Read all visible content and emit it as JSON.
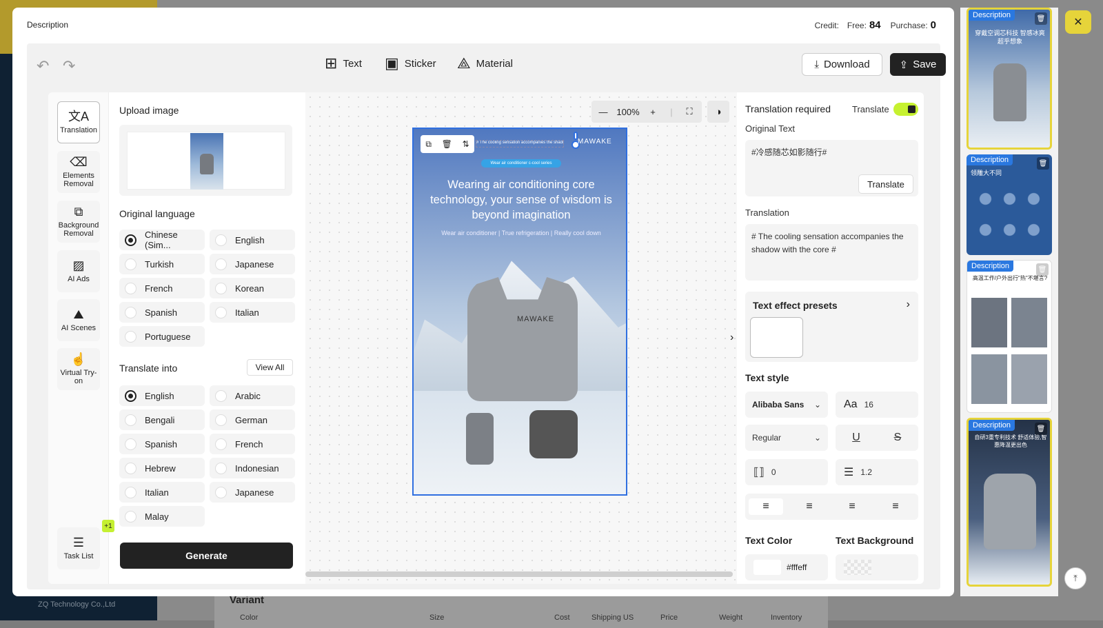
{
  "background": {
    "company": "ZQ Technology Co.,Ltd",
    "section": "Variant",
    "columns": [
      "Color",
      "Size",
      "Cost",
      "Shipping US",
      "Price",
      "Weight",
      "Inventory"
    ]
  },
  "modal": {
    "title": "Description",
    "credit": {
      "label": "Credit:",
      "free_label": "Free:",
      "free_value": "84",
      "purchase_label": "Purchase:",
      "purchase_value": "0"
    },
    "toolbar": {
      "text": "Text",
      "sticker": "Sticker",
      "material": "Material",
      "download": "Download",
      "save": "Save"
    },
    "rail": [
      {
        "label": "Translation",
        "icon": "translate-icon"
      },
      {
        "label": "Elements Removal",
        "icon": "eraser-icon"
      },
      {
        "label": "Background Removal",
        "icon": "bg-removal-icon"
      },
      {
        "label": "AI Ads",
        "icon": "ai-ads-icon"
      },
      {
        "label": "AI Scenes",
        "icon": "scene-icon"
      },
      {
        "label": "Virtual Try-on",
        "icon": "tryon-icon"
      }
    ],
    "task_list": {
      "label": "Task List",
      "badge": "+1"
    },
    "left": {
      "upload_title": "Upload image",
      "orig_title": "Original language",
      "orig_langs": [
        "Chinese (Sim...",
        "English",
        "Turkish",
        "Japanese",
        "French",
        "Korean",
        "Spanish",
        "Italian",
        "Portuguese"
      ],
      "into_title": "Translate into",
      "view_all": "View All",
      "into_langs": [
        "English",
        "Arabic",
        "Bengali",
        "German",
        "Spanish",
        "French",
        "Hebrew",
        "Indonesian",
        "Italian",
        "Japanese",
        "Malay"
      ],
      "generate": "Generate"
    },
    "canvas": {
      "zoom": "100%",
      "selected_text": "# The cooling sensation accompanies the shadow with the core #",
      "brand": "MAWAKE",
      "pill": "Wear air conditioner c-cool series",
      "headline": "Wearing air conditioning core technology, your sense of wisdom is beyond imagination",
      "subline": "Wear air conditioner | True refrigeration | Really cool down"
    },
    "right": {
      "translation_required": "Translation required",
      "translate_label": "Translate",
      "original_text_label": "Original Text",
      "original_text": "#冷感随芯如影随行#",
      "translate_btn": "Translate",
      "translation_label": "Translation",
      "translation_text": "# The cooling sensation accompanies the shadow with the core #",
      "fx_title": "Text effect presets",
      "style_title": "Text style",
      "font": "Alibaba Sans",
      "font_size": "16",
      "weight": "Regular",
      "letter_spacing": "0",
      "line_height": "1.2",
      "text_color_label": "Text Color",
      "text_bg_label": "Text Background",
      "text_color": "#fffeff"
    }
  },
  "thumbnails": [
    {
      "tag": "Description",
      "title": "穿戴空调芯科技 智感冰爽超乎想象"
    },
    {
      "tag": "Description",
      "title": "领雕大不同"
    },
    {
      "tag": "Description",
      "title": "高温工作/户外出行\"热\"不堪言?"
    },
    {
      "tag": "Description",
      "title": "自研3重专利技术 舒适体验,智惠降温更出色"
    }
  ]
}
